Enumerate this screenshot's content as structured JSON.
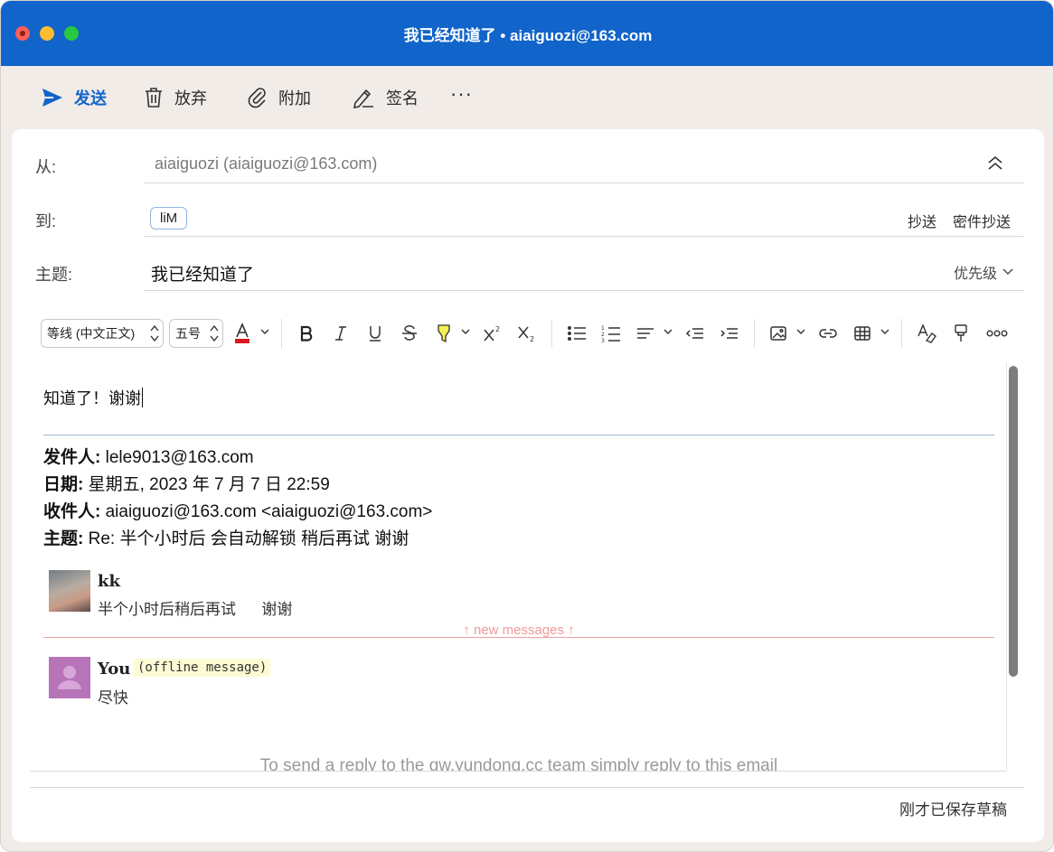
{
  "window": {
    "title": "我已经知道了 • aiaiguozi@163.com"
  },
  "toolbar": {
    "send_label": "发送",
    "discard_label": "放弃",
    "attach_label": "附加",
    "sign_label": "签名",
    "more_label": "···"
  },
  "compose": {
    "from_label": "从:",
    "from_value": "aiaiguozi (aiaiguozi@163.com)",
    "to_label": "到:",
    "to_chip": "liM",
    "cc_label": "抄送",
    "bcc_label": "密件抄送",
    "subject_label": "主题:",
    "subject_value": "我已经知道了",
    "priority_label": "优先级"
  },
  "format": {
    "font_family": "等线 (中文正文)",
    "font_size": "五号"
  },
  "body": {
    "reply_text": "知道了！谢谢",
    "quoted": {
      "from_label": "发件人:",
      "from_value": "lele9013@163.com",
      "date_label": "日期:",
      "date_value": "星期五, 2023 年 7 月 7 日 22:59",
      "to_label": "收件人:",
      "to_value": "aiaiguozi@163.com <aiaiguozi@163.com>",
      "subject_label": "主题:",
      "subject_value": "Re: 半个小时后 会自动解锁 稍后再试 谢谢"
    },
    "messages": [
      {
        "name": "kk",
        "text": "半个小时后稍后再试      谢谢"
      },
      {
        "name": "You",
        "tag": "(offline message)",
        "text": "尽快"
      }
    ],
    "new_messages_label": "↑ new messages ↑",
    "footer_hint": "To send a reply to the gw.yundong.cc team simply reply to this email"
  },
  "status": {
    "saved_text": "刚才已保存草稿"
  },
  "colors": {
    "titlebar": "#1164c9",
    "accent": "#1164c9",
    "new_messages": "#f09a9a"
  }
}
